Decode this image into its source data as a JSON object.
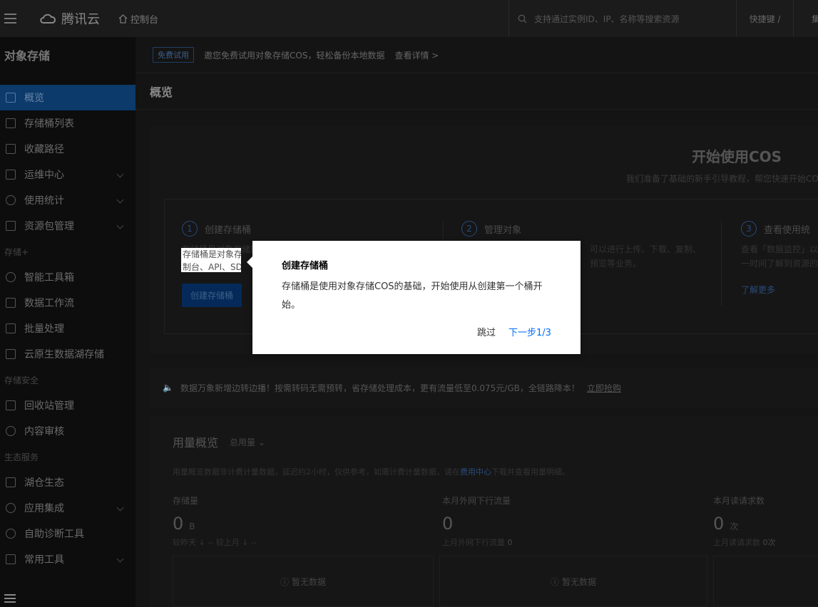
{
  "topbar": {
    "brand": "腾讯云",
    "console": "控制台",
    "search_placeholder": "支持通过实例ID、IP、名称等搜索资源",
    "shortcut": "快捷键 /",
    "more": "集"
  },
  "sidebar": {
    "title": "对象存储",
    "items": [
      {
        "label": "概览",
        "active": true
      },
      {
        "label": "存储桶列表"
      },
      {
        "label": "收藏路径"
      },
      {
        "label": "运维中心",
        "chevron": true
      },
      {
        "label": "使用统计",
        "chevron": true
      },
      {
        "label": "资源包管理",
        "chevron": true
      }
    ],
    "group_storage_plus": "存储+",
    "items2": [
      {
        "label": "智能工具箱"
      },
      {
        "label": "数据工作流"
      },
      {
        "label": "批量处理"
      },
      {
        "label": "云原生数据湖存储"
      }
    ],
    "group_security": "存储安全",
    "items3": [
      {
        "label": "回收站管理"
      },
      {
        "label": "内容审核"
      }
    ],
    "group_eco": "生态服务",
    "items4": [
      {
        "label": "湖仓生态"
      },
      {
        "label": "应用集成",
        "chevron": true
      },
      {
        "label": "自助诊断工具"
      },
      {
        "label": "常用工具",
        "chevron": true
      }
    ]
  },
  "promo": {
    "tag": "免费试用",
    "text": "邀您免费试用对象存储COS，轻松备份本地数据",
    "link": "查看详情 >"
  },
  "page_title": "概览",
  "start": {
    "title": "开始使用COS",
    "subtitle": "我们准备了基础的新手引导教程，帮您快速开始COS之",
    "steps": [
      {
        "num": "1",
        "title": "创建存储桶",
        "desc": "存储桶是对象存储的基础，您可以通过控制台、API、SDK 创建存储桶。",
        "action": "创建存储桶"
      },
      {
        "num": "2",
        "title": "管理对象",
        "desc": "可以进行上传、下载、复制、预览等业务。",
        "action": ""
      },
      {
        "num": "3",
        "title": "查看使用统",
        "desc": "查看「数据监控」以一时间了解到资源的",
        "action": "了解更多"
      }
    ]
  },
  "highlight": {
    "line1": "存储桶是对象存",
    "line2": "制台、API、SD"
  },
  "notice": {
    "text": "数据万象新增边转边播！按需转码无需预转，省存储处理成本，更有流量低至0.075元/GB，全链路降本！",
    "link": "立即抢购"
  },
  "usage": {
    "title": "用量概览",
    "select": "总用量",
    "note_prefix": "用量概览数据非计费计量数据，延迟约2小时，仅供参考，如需计费计量数据，请在",
    "note_link": "费用中心",
    "note_suffix": "下载并查看用量明细。",
    "metrics": [
      {
        "label": "存储量",
        "value": "0",
        "unit": "B",
        "sub": "较昨天 ↓ --    较上月 ↓ --"
      },
      {
        "label": "本月外网下行流量",
        "value": "0",
        "unit": "",
        "sub": "上月外网下行流量",
        "sub_val": "0"
      },
      {
        "label": "本月读请求数",
        "value": "0",
        "unit": "次",
        "sub": "上月读请求数",
        "sub_val": "0次"
      }
    ],
    "no_data": "暂无数据"
  },
  "popover": {
    "title": "创建存储桶",
    "body": "存储桶是使用对象存储COS的基础，开始使用从创建第一个桶开始。",
    "skip": "跳过",
    "next": "下一步1/3"
  }
}
